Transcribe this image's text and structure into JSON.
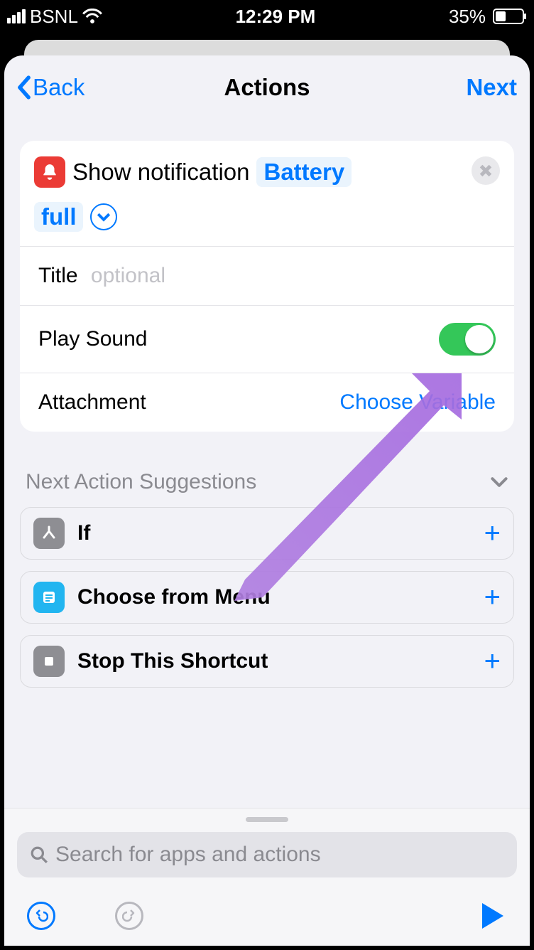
{
  "status": {
    "carrier": "BSNL",
    "time": "12:29 PM",
    "battery_pct": "35%"
  },
  "nav": {
    "back": "Back",
    "title": "Actions",
    "next": "Next"
  },
  "action_card": {
    "prefix": "Show notification",
    "param1": "Battery",
    "param2": "full",
    "rows": {
      "title_label": "Title",
      "title_placeholder": "optional",
      "play_sound_label": "Play Sound",
      "attachment_label": "Attachment",
      "attachment_value": "Choose Variable"
    }
  },
  "suggestions": {
    "header": "Next Action Suggestions",
    "items": [
      {
        "label": "If"
      },
      {
        "label": "Choose from Menu"
      },
      {
        "label": "Stop This Shortcut"
      }
    ]
  },
  "search": {
    "placeholder": "Search for apps and actions"
  }
}
